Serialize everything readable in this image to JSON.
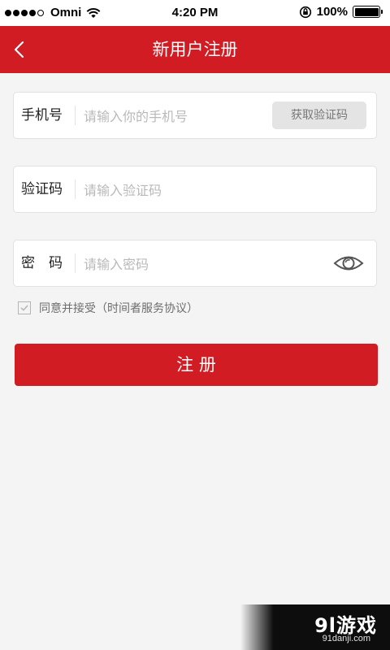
{
  "status_bar": {
    "carrier": "Omni",
    "time": "4:20 PM",
    "battery_percent": "100%"
  },
  "nav": {
    "title": "新用户注册"
  },
  "form": {
    "phone": {
      "label": "手机号",
      "placeholder": "请输入你的手机号",
      "value": "",
      "code_button_label": "获取验证码"
    },
    "code": {
      "label": "验证码",
      "placeholder": "请输入验证码",
      "value": ""
    },
    "password": {
      "label": "密　码",
      "placeholder": "请输入密码",
      "value": ""
    },
    "agreement": {
      "checked": true,
      "text": "同意并接受（时间者服务协议）"
    },
    "submit_label": "注 册"
  },
  "watermark": {
    "big": "9l游戏",
    "small": "91danji.com"
  },
  "colors": {
    "primary": "#d11c24",
    "background": "#f4f4f4"
  }
}
